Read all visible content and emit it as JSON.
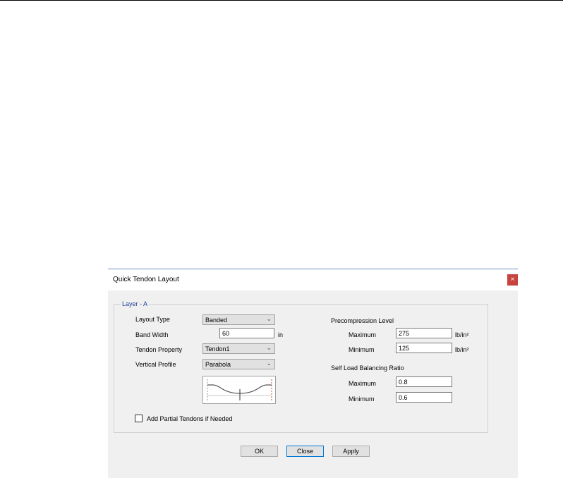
{
  "dialog": {
    "title": "Quick Tendon Layout",
    "close_glyph": "×"
  },
  "group": {
    "legend": "Layer - A"
  },
  "left": {
    "layout_type_label": "Layout Type",
    "layout_type_value": "Banded",
    "band_width_label": "Band Width",
    "band_width_value": "60",
    "band_width_unit": "in",
    "tendon_property_label": "Tendon Property",
    "tendon_property_value": "Tendon1",
    "vertical_profile_label": "Vertical Profile",
    "vertical_profile_value": "Parabola",
    "partial_tendons_label": "Add Partial Tendons if Needed",
    "partial_tendons_checked": false
  },
  "right": {
    "precompression_heading": "Precompression Level",
    "pc_max_label": "Maximum",
    "pc_max_value": "275",
    "pc_max_unit": "lb/in²",
    "pc_min_label": "Minimum",
    "pc_min_value": "125",
    "pc_min_unit": "lb/in²",
    "balancing_heading": "Self Load Balancing Ratio",
    "bal_max_label": "Maximum",
    "bal_max_value": "0.8",
    "bal_min_label": "Minimum",
    "bal_min_value": "0.6"
  },
  "buttons": {
    "ok": "OK",
    "close": "Close",
    "apply": "Apply"
  },
  "icons": {
    "combo_chevron": "chevron-down-icon",
    "close": "close-icon"
  },
  "colors": {
    "close_button": "#c7433d",
    "legend_text": "#1f3f9a",
    "focus_border": "#0078d7"
  }
}
